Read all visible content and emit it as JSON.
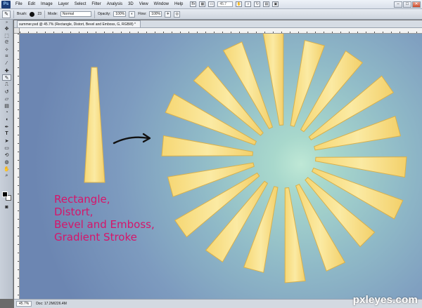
{
  "app": {
    "logo": "Ps",
    "menu": [
      "File",
      "Edit",
      "Image",
      "Layer",
      "Select",
      "Filter",
      "Analysis",
      "3D",
      "View",
      "Window",
      "Help"
    ],
    "zoom_field": "45.7"
  },
  "options": {
    "brush_label": "Brush:",
    "brush_size": "23",
    "mode_label": "Mode:",
    "mode_value": "Normal",
    "opacity_label": "Opacity:",
    "opacity_value": "100%",
    "flow_label": "Flow:",
    "flow_value": "100%"
  },
  "document": {
    "tab_title": "summer.psd @ 45.7% (Rectangle,        Distort,        Bevel and Emboss,     G, RGB/8) *"
  },
  "canvas": {
    "caption_lines": [
      "Rectangle,",
      "Distort,",
      "Bevel and Emboss,",
      "Gradient Stroke"
    ],
    "caption_color": "#d6156a",
    "ray_color": "#f7e08a",
    "ray_count": 18
  },
  "status": {
    "zoom": "45.7%",
    "doc_info": "Doc: 17.2M/226.4M"
  },
  "watermark": "pxleyes.com"
}
